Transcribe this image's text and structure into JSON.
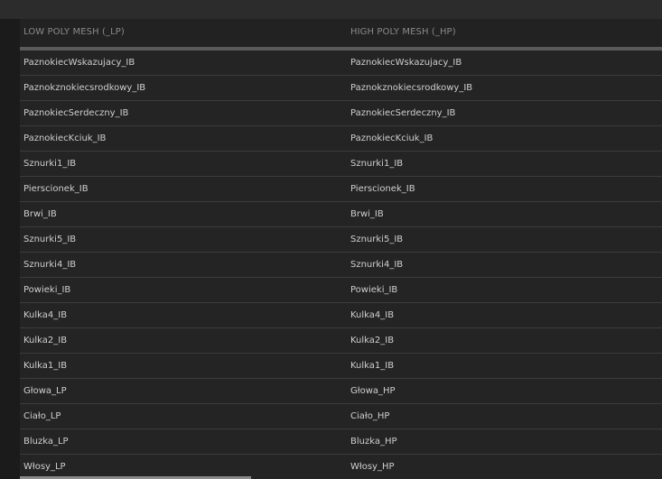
{
  "table": {
    "columns": [
      "LOW POLY MESH (_LP)",
      "HIGH POLY MESH (_HP)"
    ],
    "rows": [
      {
        "lp": "PaznokiecWskazujacy_IB",
        "hp": "PaznokiecWskazujacy_IB"
      },
      {
        "lp": "Paznokznokiecsrodkowy_IB",
        "hp": "Paznokznokiecsrodkowy_IB"
      },
      {
        "lp": "PaznokiecSerdeczny_IB",
        "hp": "PaznokiecSerdeczny_IB"
      },
      {
        "lp": "PaznokiecKciuk_IB",
        "hp": "PaznokiecKciuk_IB"
      },
      {
        "lp": "Sznurki1_IB",
        "hp": "Sznurki1_IB"
      },
      {
        "lp": "Pierscionek_IB",
        "hp": "Pierscionek_IB"
      },
      {
        "lp": "Brwi_IB",
        "hp": "Brwi_IB"
      },
      {
        "lp": "Sznurki5_IB",
        "hp": "Sznurki5_IB"
      },
      {
        "lp": "Sznurki4_IB",
        "hp": "Sznurki4_IB"
      },
      {
        "lp": "Powieki_IB",
        "hp": "Powieki_IB"
      },
      {
        "lp": "Kulka4_IB",
        "hp": "Kulka4_IB"
      },
      {
        "lp": "Kulka2_IB",
        "hp": "Kulka2_IB"
      },
      {
        "lp": "Kulka1_IB",
        "hp": "Kulka1_IB"
      },
      {
        "lp": "Głowa_LP",
        "hp": "Głowa_HP"
      },
      {
        "lp": "Ciało_LP",
        "hp": "Ciało_HP"
      },
      {
        "lp": "Bluzka_LP",
        "hp": "Bluzka_HP"
      },
      {
        "lp": "Włosy_LP",
        "hp": "Włosy_HP"
      }
    ]
  }
}
